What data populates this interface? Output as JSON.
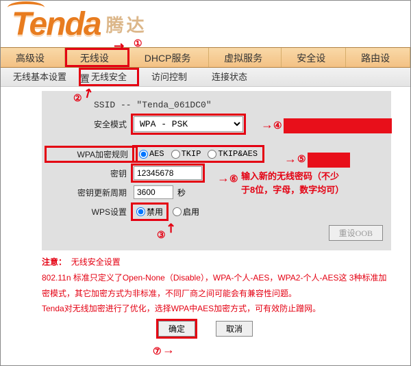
{
  "brand": {
    "en": "Tenda",
    "cn": "腾达"
  },
  "nav": {
    "items": [
      "高级设置",
      "无线设置",
      "DHCP服务器",
      "虚拟服务器",
      "安全设置",
      "路由设置"
    ],
    "highlight_index": 1
  },
  "subnav": {
    "items": [
      "无线基本设置",
      "无线安全",
      "访问控制",
      "连接状态"
    ],
    "highlight_index": 1
  },
  "form": {
    "ssid_line": "SSID -- \"Tenda_061DC0\"",
    "sec_mode_label": "安全模式",
    "sec_mode_value": "WPA - PSK",
    "wpa_rule_label": "WPA加密规则",
    "wpa_rule_options": [
      "AES",
      "TKIP",
      "TKIP&AES"
    ],
    "wpa_rule_selected": "AES",
    "key_label": "密钥",
    "key_value": "12345678",
    "key_interval_label": "密钥更新周期",
    "key_interval_value": "3600",
    "key_interval_unit": "秒",
    "wps_label": "WPS设置",
    "wps_options": [
      "禁用",
      "启用"
    ],
    "wps_selected": "禁用",
    "reset_btn": "重设OOB"
  },
  "notes": {
    "header_lead": "注意：",
    "header_rest": "无线安全设置",
    "line1": "802.11n 标准只定义了Open-None（Disable），WPA-个人-AES，WPA2-个人-AES这 3种标准加密模式，其它加密方式为非标准，不同厂商之间可能会有兼容性问题。",
    "line2": "Tenda对无线加密进行了优化，选择WPA中AES加密方式，可有效防止蹭网。"
  },
  "buttons": {
    "ok": "确定",
    "cancel": "取消"
  },
  "annotations": {
    "m1": "①",
    "m2": "②",
    "m3": "③",
    "m4": "④",
    "m5": "⑤",
    "m6": "⑥",
    "m7": "⑦",
    "key_hint_l1": "输入新的无线密码（不少",
    "key_hint_l2": "于8位，字母，数字均可）"
  }
}
